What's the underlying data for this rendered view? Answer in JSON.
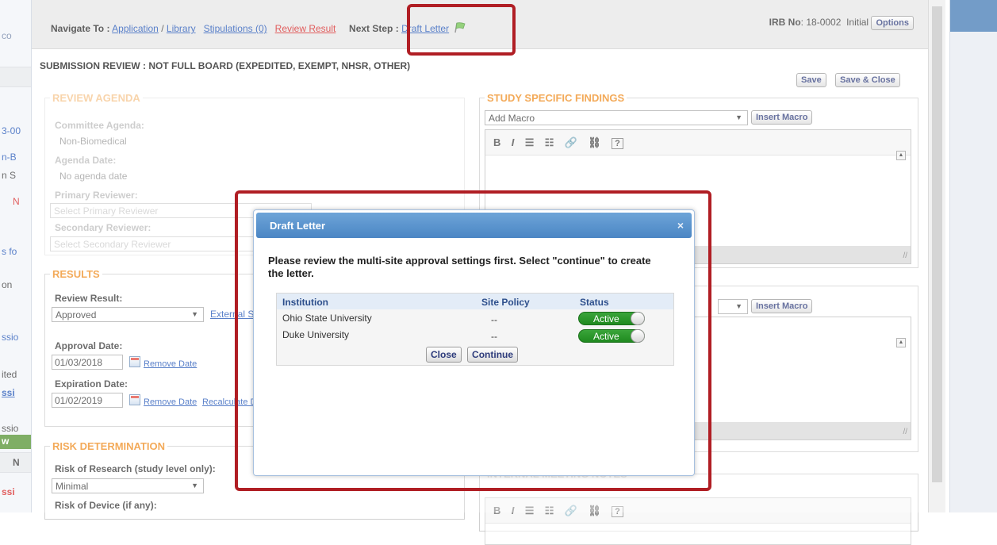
{
  "colors": {
    "accent_orange": "#ef8a1a",
    "link_blue": "#1a4fb5",
    "link_red": "#d61f1f",
    "modal_title_bg": "#4b86c4",
    "toggle_green": "#1f8a1f",
    "annotation_red": "#b01e24"
  },
  "left_pane": [
    "co",
    "3-00",
    "n-B",
    "n S",
    "N",
    "s fo",
    "on",
    "ssio",
    "ited",
    "ssi",
    "ssio",
    "w",
    "N",
    "ssi"
  ],
  "nav": {
    "label": "Navigate To :",
    "application": "Application",
    "sep": "/",
    "library": "Library",
    "stipulations": "Stipulations (0)",
    "review_result": "Review Result",
    "next_step_label": "Next Step :",
    "next_step": "Draft Letter",
    "flag_icon": "green-flag-icon"
  },
  "irb": {
    "label": "IRB No",
    "colon": ":",
    "number": "18-0002",
    "status": "Initial",
    "options": "Options"
  },
  "page_title": "SUBMISSION REVIEW : NOT FULL BOARD (EXPEDITED, EXEMPT, NHSR, OTHER)",
  "save": "Save",
  "save_close": "Save & Close",
  "review_agenda": {
    "legend": "REVIEW AGENDA",
    "committee_label": "Committee Agenda:",
    "committee_value": "Non-Biomedical",
    "date_label": "Agenda Date:",
    "date_value": "No agenda date",
    "primary_label": "Primary Reviewer:",
    "primary_placeholder": "Select Primary Reviewer",
    "secondary_label": "Secondary Reviewer:",
    "secondary_placeholder": "Select Secondary Reviewer"
  },
  "results": {
    "legend": "RESULTS",
    "review_result_label": "Review Result:",
    "review_result_value": "Approved",
    "external_link": "External S",
    "approval_label": "Approval Date:",
    "approval_value": "01/03/2018",
    "remove_date": "Remove Date",
    "expiration_label": "Expiration Date:",
    "expiration_value": "01/02/2019",
    "recalculate": "Recalculate D"
  },
  "risk": {
    "legend": "RISK DETERMINATION",
    "research_label": "Risk of Research (study level only):",
    "research_value": "Minimal",
    "device_label": "Risk of Device (if any):"
  },
  "findings": {
    "legend": "STUDY SPECIFIC FINDINGS",
    "macro_placeholder": "Add Macro",
    "insert_macro": "Insert Macro",
    "toolbar": [
      "B",
      "I",
      "☰",
      "☷",
      "🔗",
      "⛓",
      "?"
    ]
  },
  "caret": "▼",
  "up_arrow": "▲",
  "grip": "//",
  "internal_notes_legend": "INTERNAL MEETING NOTES",
  "modal": {
    "title": "Draft Letter",
    "close_icon": "×",
    "message": "Please review the multi-site approval settings first. Select \"continue\" to create the letter.",
    "columns": [
      "Institution",
      "Site Policy",
      "Status"
    ],
    "rows": [
      {
        "institution": "Ohio State University",
        "policy": "--",
        "status": "Active"
      },
      {
        "institution": "Duke University",
        "policy": "--",
        "status": "Active"
      }
    ],
    "close_btn": "Close",
    "continue_btn": "Continue"
  }
}
